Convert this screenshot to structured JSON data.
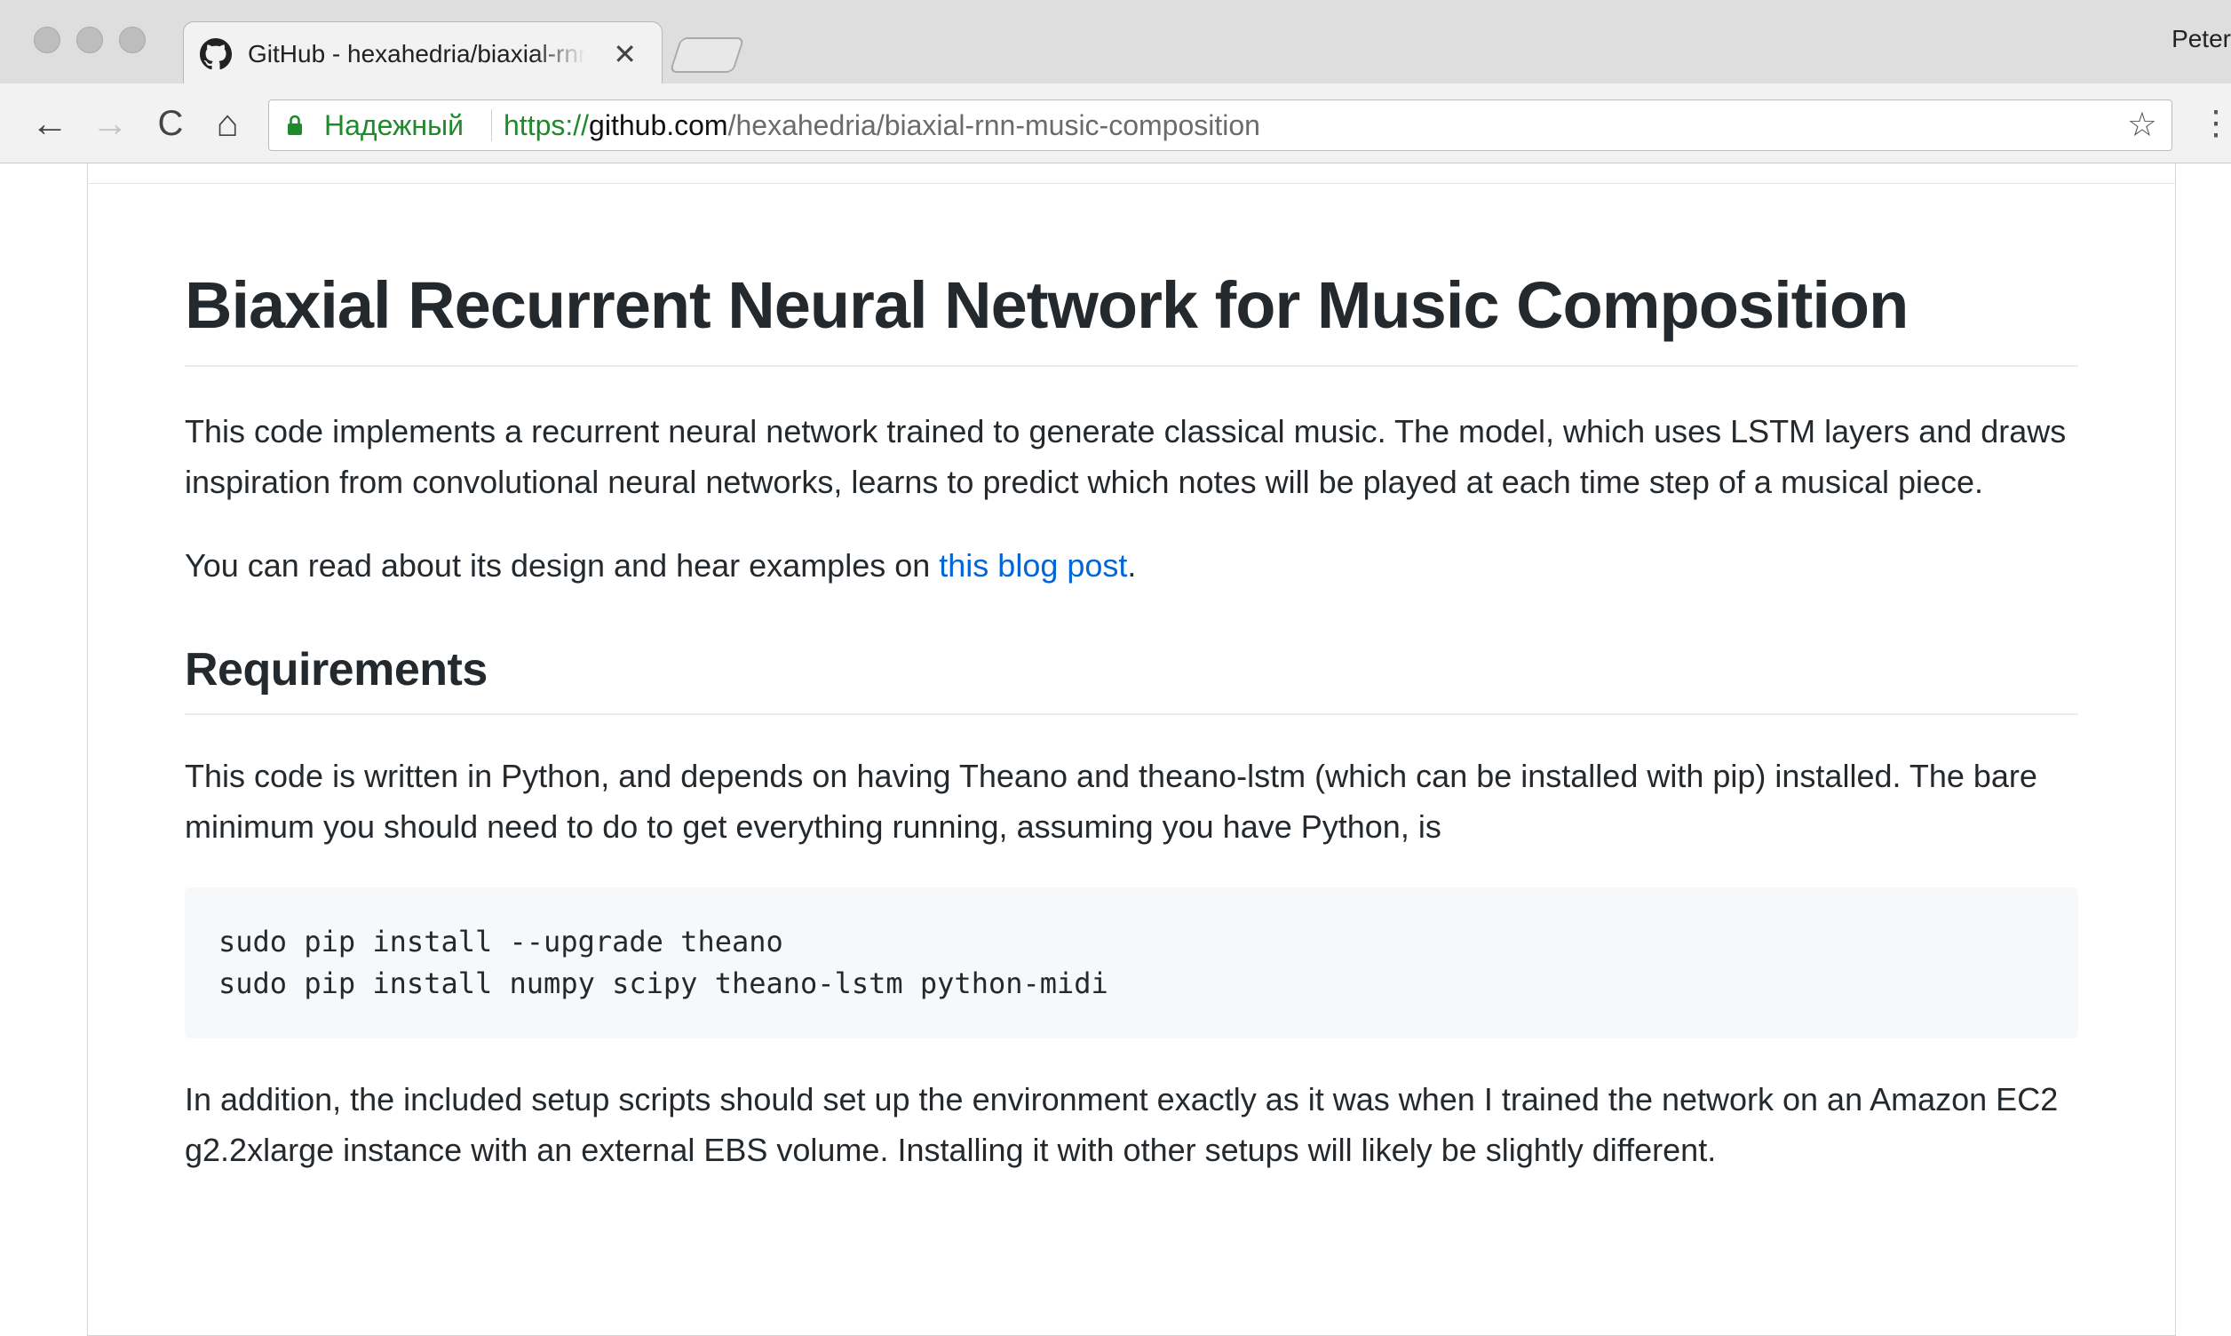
{
  "browser": {
    "tab": {
      "title": "GitHub - hexahedria/biaxial-rnn-music-composition",
      "close_glyph": "✕"
    },
    "profile_name": "Peter",
    "nav": {
      "back": "←",
      "forward": "→",
      "reload": "C",
      "home": "⌂"
    },
    "address_bar": {
      "secure_label": "Надежный",
      "url_scheme": "https://",
      "url_host": "github.com",
      "url_path": "/hexahedria/biaxial-rnn-music-composition"
    },
    "bookmark_star": "☆",
    "menu_glyph": "⋮"
  },
  "readme": {
    "title": "Biaxial Recurrent Neural Network for Music Composition",
    "intro": "This code implements a recurrent neural network trained to generate classical music. The model, which uses LSTM layers and draws inspiration from convolutional neural networks, learns to predict which notes will be played at each time step of a musical piece.",
    "blog_sentence_prefix": "You can read about its design and hear examples on ",
    "blog_link_text": "this blog post",
    "blog_sentence_suffix": ".",
    "requirements": {
      "heading": "Requirements",
      "text": "This code is written in Python, and depends on having Theano and theano-lstm (which can be installed with pip) installed. The bare minimum you should need to do to get everything running, assuming you have Python, is",
      "code": "sudo pip install --upgrade theano\nsudo pip install numpy scipy theano-lstm python-midi",
      "after_code": "In addition, the included setup scripts should set up the environment exactly as it was when I trained the network on an Amazon EC2 g2.2xlarge instance with an external EBS volume. Installing it with other setups will likely be slightly different."
    }
  },
  "colors": {
    "link": "#0366d6",
    "text": "#24292e",
    "secure_green": "#1f8a2c",
    "code_bg": "#f6f8fa"
  }
}
